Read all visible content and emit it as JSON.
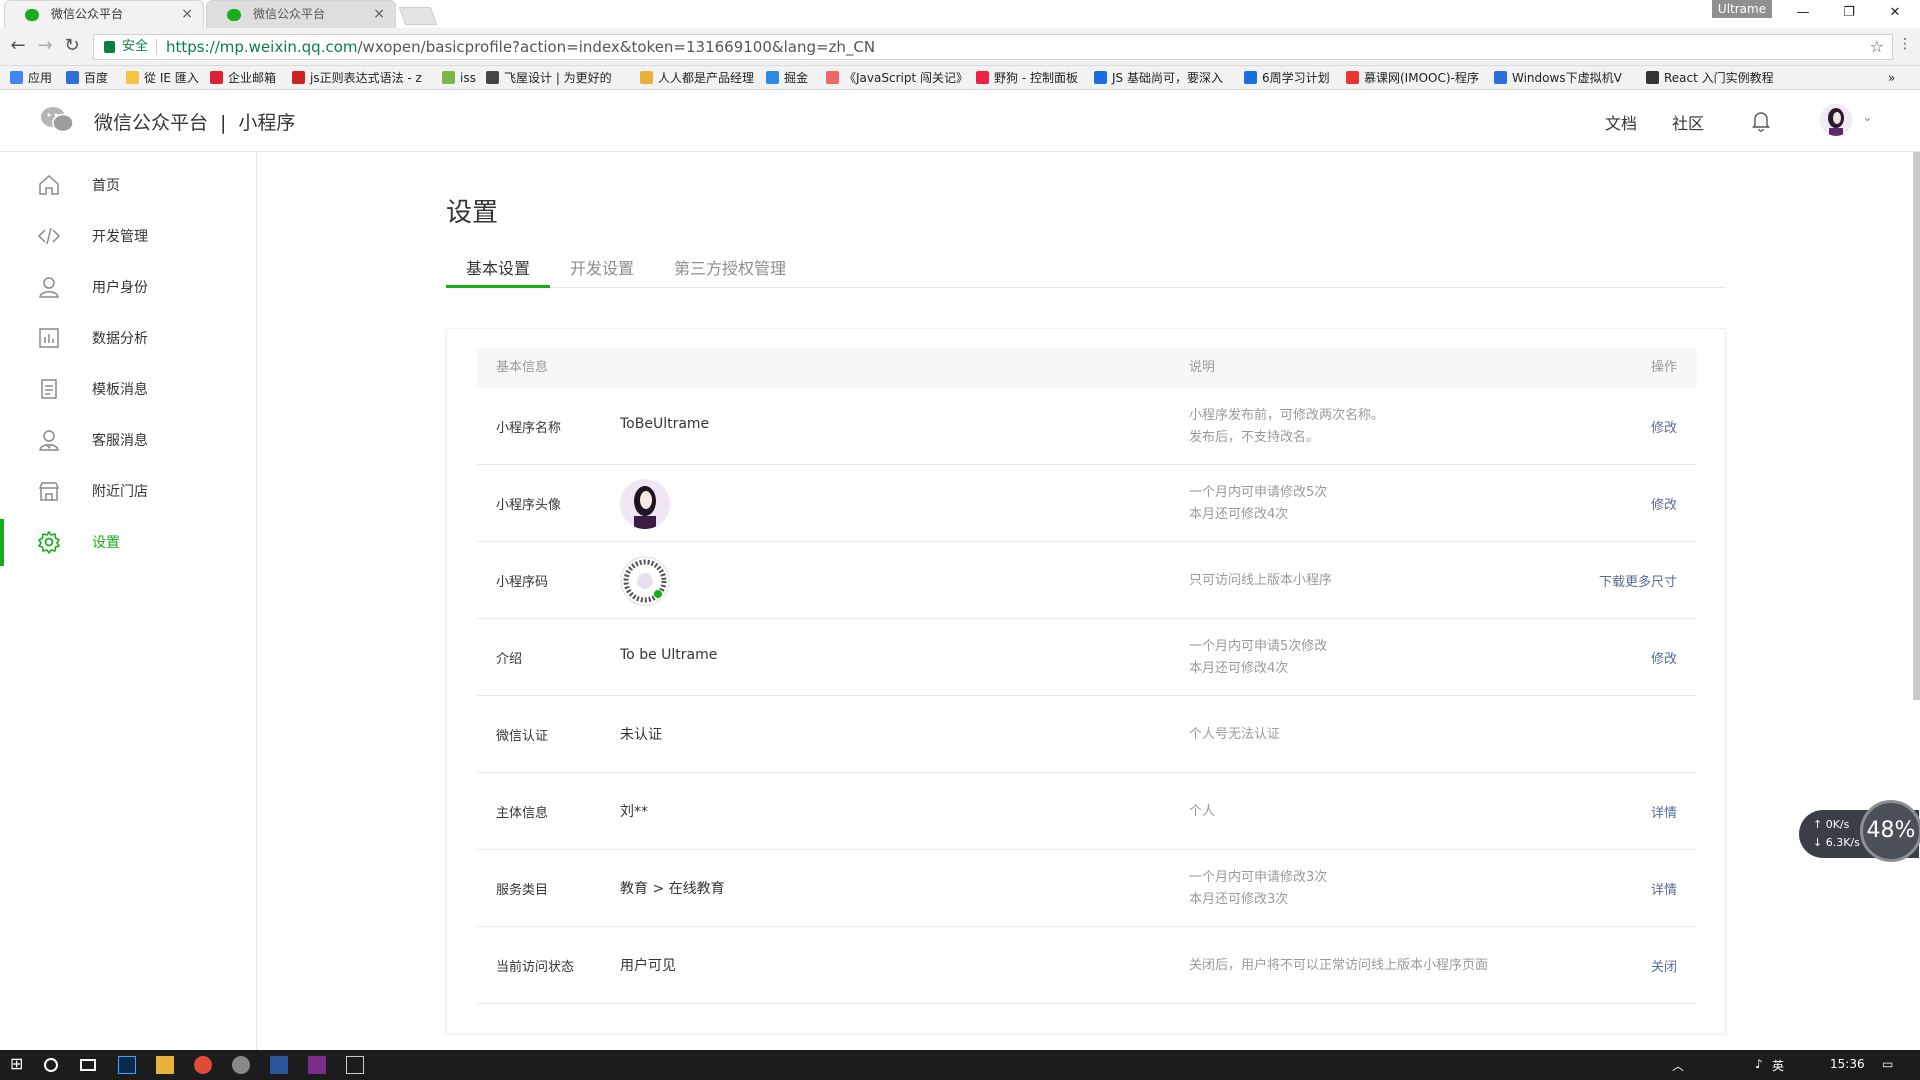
{
  "browser": {
    "tabs": [
      {
        "label": "微信公众平台"
      },
      {
        "label": "微信公众平台"
      }
    ],
    "window_badge": "Ultrame",
    "secure_label": "安全",
    "url_host": "https://mp.weixin.qq.com",
    "url_path": "/wxopen/basicprofile?action=index&token=131669100&lang=zh_CN",
    "bookmarks": [
      "应用",
      "百度",
      "從 IE 匯入",
      "企业邮箱",
      "js正则表达式语法 - z",
      "iss",
      "飞屋设计 | 为更好的",
      "人人都是产品经理",
      "掘金",
      "《JavaScript 闯关记》",
      "野狗 - 控制面板",
      "JS 基础尚可，要深入",
      "6周学习计划",
      "慕课网(IMOOC)-程序",
      "Windows下虚拟机V",
      "React 入门实例教程"
    ],
    "bookmarks_more": "»"
  },
  "header": {
    "brand": "微信公众平台",
    "brand_sub": "小程序",
    "docs": "文档",
    "community": "社区"
  },
  "sidebar": {
    "items": [
      {
        "label": "首页",
        "icon": "home-icon"
      },
      {
        "label": "开发管理",
        "icon": "code-icon"
      },
      {
        "label": "用户身份",
        "icon": "user-icon"
      },
      {
        "label": "数据分析",
        "icon": "chart-icon"
      },
      {
        "label": "模板消息",
        "icon": "document-icon"
      },
      {
        "label": "客服消息",
        "icon": "support-icon"
      },
      {
        "label": "附近门店",
        "icon": "store-icon"
      },
      {
        "label": "设置",
        "icon": "gear-icon"
      }
    ],
    "active": "设置"
  },
  "main": {
    "title": "设置",
    "tabs": [
      "基本设置",
      "开发设置",
      "第三方授权管理"
    ],
    "table_headers": {
      "info": "基本信息",
      "desc": "说明",
      "op": "操作"
    },
    "rows": [
      {
        "label": "小程序名称",
        "value": "ToBeUltrame",
        "desc1": "小程序发布前，可修改两次名称。",
        "desc2": "发布后，不支持改名。",
        "action": "修改"
      },
      {
        "label": "小程序头像",
        "value": "",
        "desc1": "一个月内可申请修改5次",
        "desc2": "本月还可修改4次",
        "action": "修改"
      },
      {
        "label": "小程序码",
        "value": "",
        "desc1": "只可访问线上版本小程序",
        "desc2": "",
        "action": "下载更多尺寸"
      },
      {
        "label": "介绍",
        "value": "To be Ultrame",
        "desc1": "一个月内可申请5次修改",
        "desc2": "本月还可修改4次",
        "action": "修改"
      },
      {
        "label": "微信认证",
        "value": "未认证",
        "desc1": "个人号无法认证",
        "desc2": "",
        "action": ""
      },
      {
        "label": "主体信息",
        "value": "刘**",
        "desc1": "个人",
        "desc2": "",
        "action": "详情"
      },
      {
        "label": "服务类目",
        "value": "教育 > 在线教育",
        "desc1": "一个月内可申请修改3次",
        "desc2": "本月还可修改3次",
        "action": "详情"
      },
      {
        "label": "当前访问状态",
        "value": "用户可见",
        "desc1": "关闭后，用户将不可以正常访问线上版本小程序页面",
        "desc2": "",
        "action": "关闭"
      }
    ]
  },
  "net_widget": {
    "up": "0K/s",
    "down": "6.3K/s",
    "percent": "48%"
  },
  "taskbar": {
    "time": "15:36",
    "ime": "英"
  },
  "colors": {
    "accent": "#1aad19",
    "link": "#576b95",
    "muted": "#9a9a9a"
  }
}
